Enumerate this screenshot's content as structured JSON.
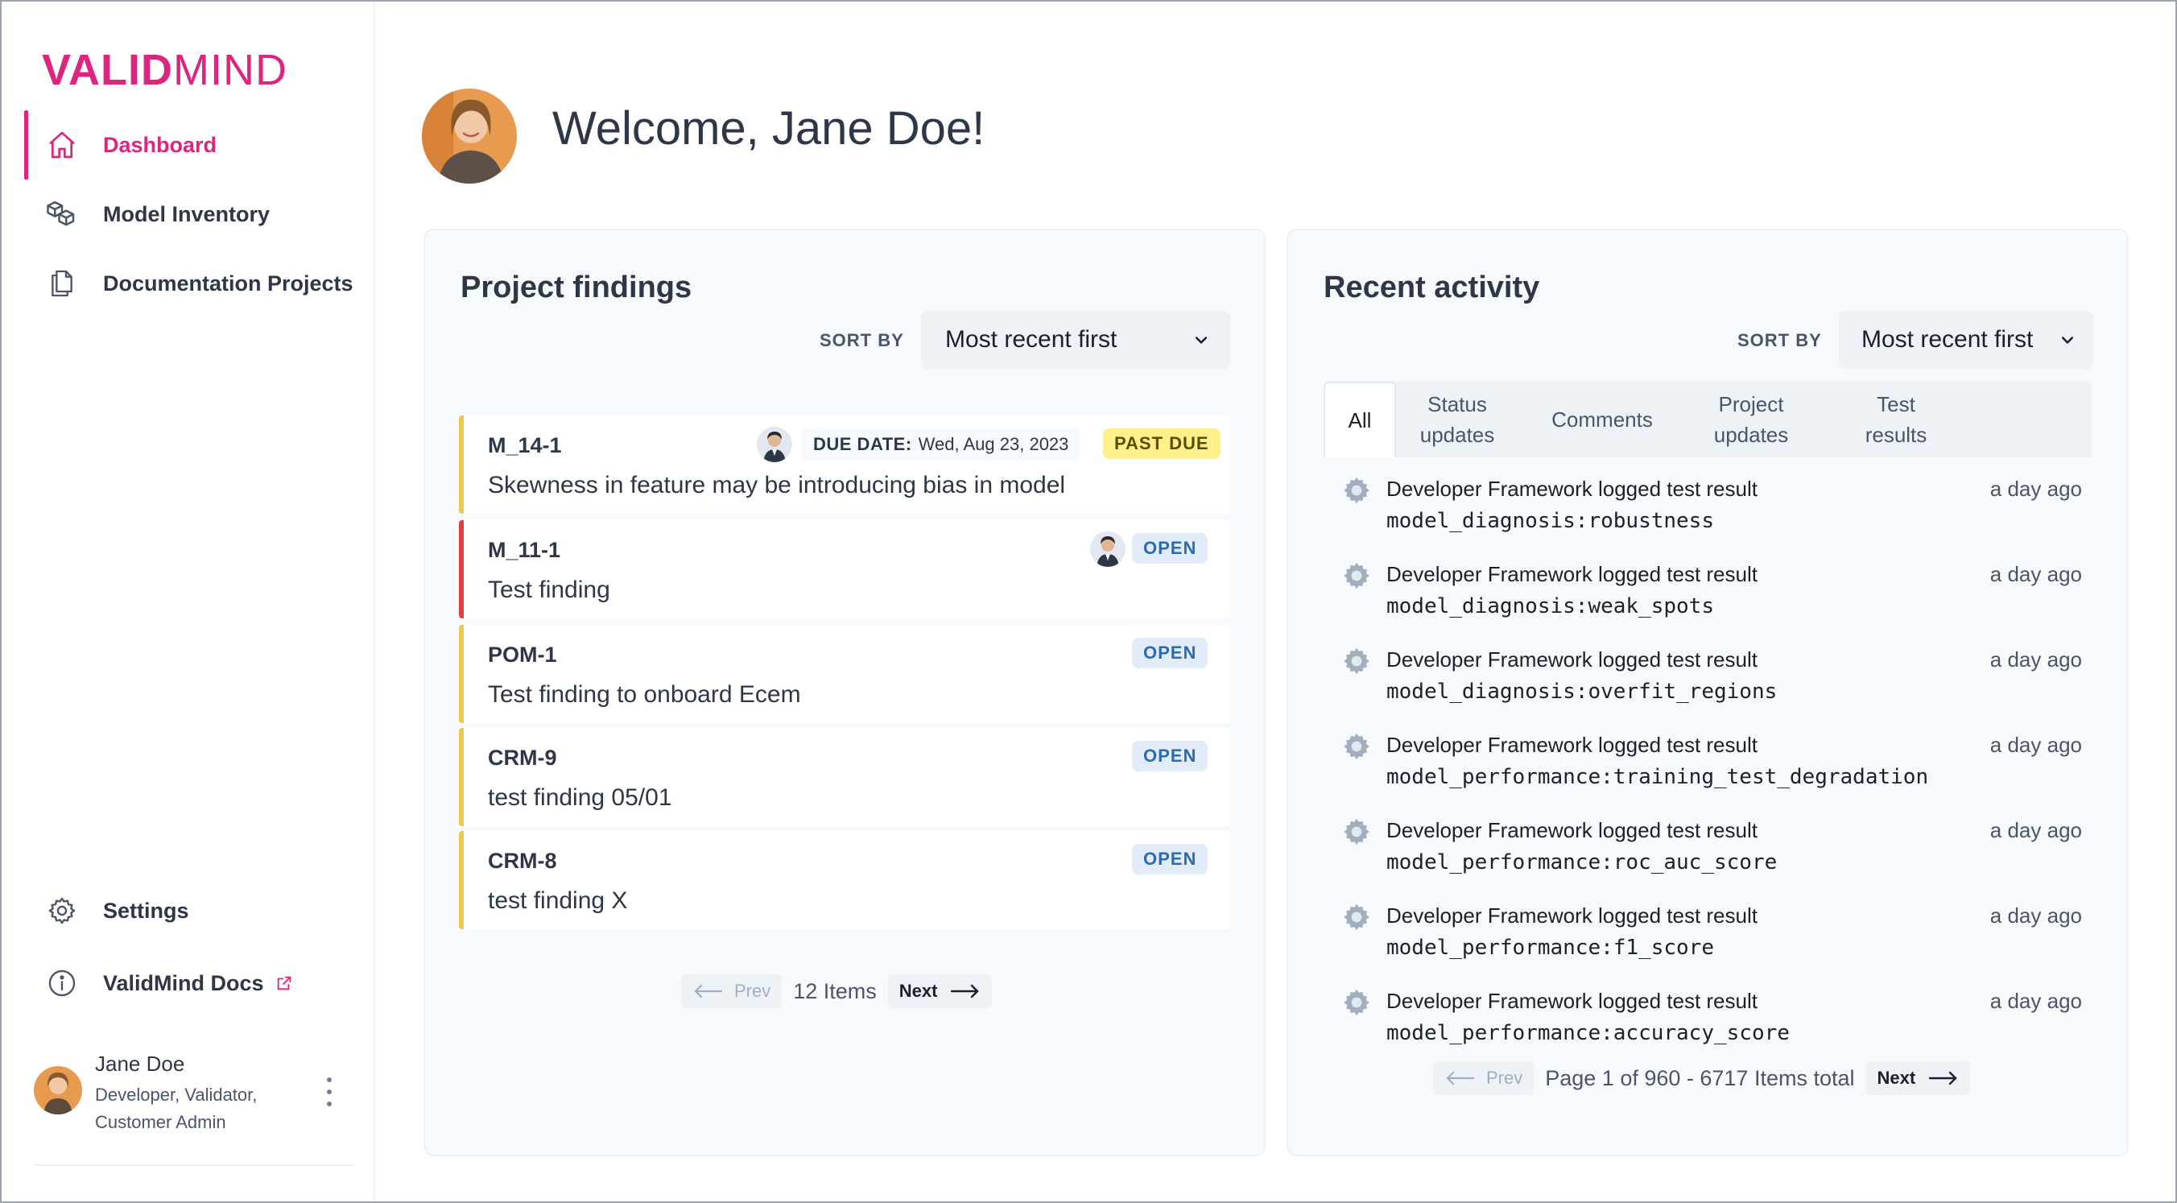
{
  "sidebar": {
    "logo": {
      "bold": "VALID",
      "light": "MIND"
    },
    "nav": [
      {
        "label": "Dashboard",
        "icon": "home-icon",
        "active": true
      },
      {
        "label": "Model Inventory",
        "icon": "cubes-icon"
      },
      {
        "label": "Documentation Projects",
        "icon": "documents-icon"
      }
    ],
    "bottom_nav": [
      {
        "label": "Settings",
        "icon": "gear-icon"
      },
      {
        "label": "ValidMind Docs",
        "icon": "info-icon",
        "external": true
      }
    ],
    "user": {
      "name": "Jane Doe",
      "roles": "Developer, Validator, Customer Admin"
    }
  },
  "welcome": {
    "title": "Welcome, Jane Doe!"
  },
  "findings": {
    "title": "Project findings",
    "sort_label": "SORT BY",
    "sort_value": "Most recent first",
    "items": [
      {
        "id": "M_14-1",
        "text": "Skewness in feature may be introducing bias in model",
        "due_label": "DUE DATE:",
        "due_value": "Wed, Aug 23, 2023",
        "status": "PAST DUE",
        "color": "#ECC94B"
      },
      {
        "id": "M_11-1",
        "text": "Test finding",
        "status": "OPEN",
        "color": "#E53E3E"
      },
      {
        "id": "POM-1",
        "text": "Test finding to onboard Ecem",
        "status": "OPEN",
        "color": "#ECC94B"
      },
      {
        "id": "CRM-9",
        "text": "test finding 05/01",
        "status": "OPEN",
        "color": "#ECC94B"
      },
      {
        "id": "CRM-8",
        "text": "test finding X",
        "status": "OPEN",
        "color": "#ECC94B"
      }
    ],
    "pager": {
      "prev": "Prev",
      "info": "12 Items",
      "next": "Next"
    }
  },
  "activity": {
    "title": "Recent activity",
    "sort_label": "SORT BY",
    "sort_value": "Most recent first",
    "tabs": [
      {
        "label": "All",
        "active": true
      },
      {
        "label": "Status updates"
      },
      {
        "label": "Comments"
      },
      {
        "label": "Project updates"
      },
      {
        "label": "Test results"
      }
    ],
    "items": [
      {
        "text": "Developer Framework logged test result",
        "code": "model_diagnosis:robustness",
        "time": "a day ago"
      },
      {
        "text": "Developer Framework logged test result",
        "code": "model_diagnosis:weak_spots",
        "time": "a day ago"
      },
      {
        "text": "Developer Framework logged test result",
        "code": "model_diagnosis:overfit_regions",
        "time": "a day ago"
      },
      {
        "text": "Developer Framework logged test result",
        "code": "model_performance:training_test_degradation",
        "time": "a day ago"
      },
      {
        "text": "Developer Framework logged test result",
        "code": "model_performance:roc_auc_score",
        "time": "a day ago"
      },
      {
        "text": "Developer Framework logged test result",
        "code": "model_performance:f1_score",
        "time": "a day ago"
      },
      {
        "text": "Developer Framework logged test result",
        "code": "model_performance:accuracy_score",
        "time": "a day ago"
      }
    ],
    "pager": {
      "prev": "Prev",
      "info": "Page 1 of 960 - 6717 Items total",
      "next": "Next"
    }
  },
  "colors": {
    "brand": "#DE257E",
    "open_badge": "#2B6CB0",
    "past_due_badge": "#FEF08A"
  }
}
